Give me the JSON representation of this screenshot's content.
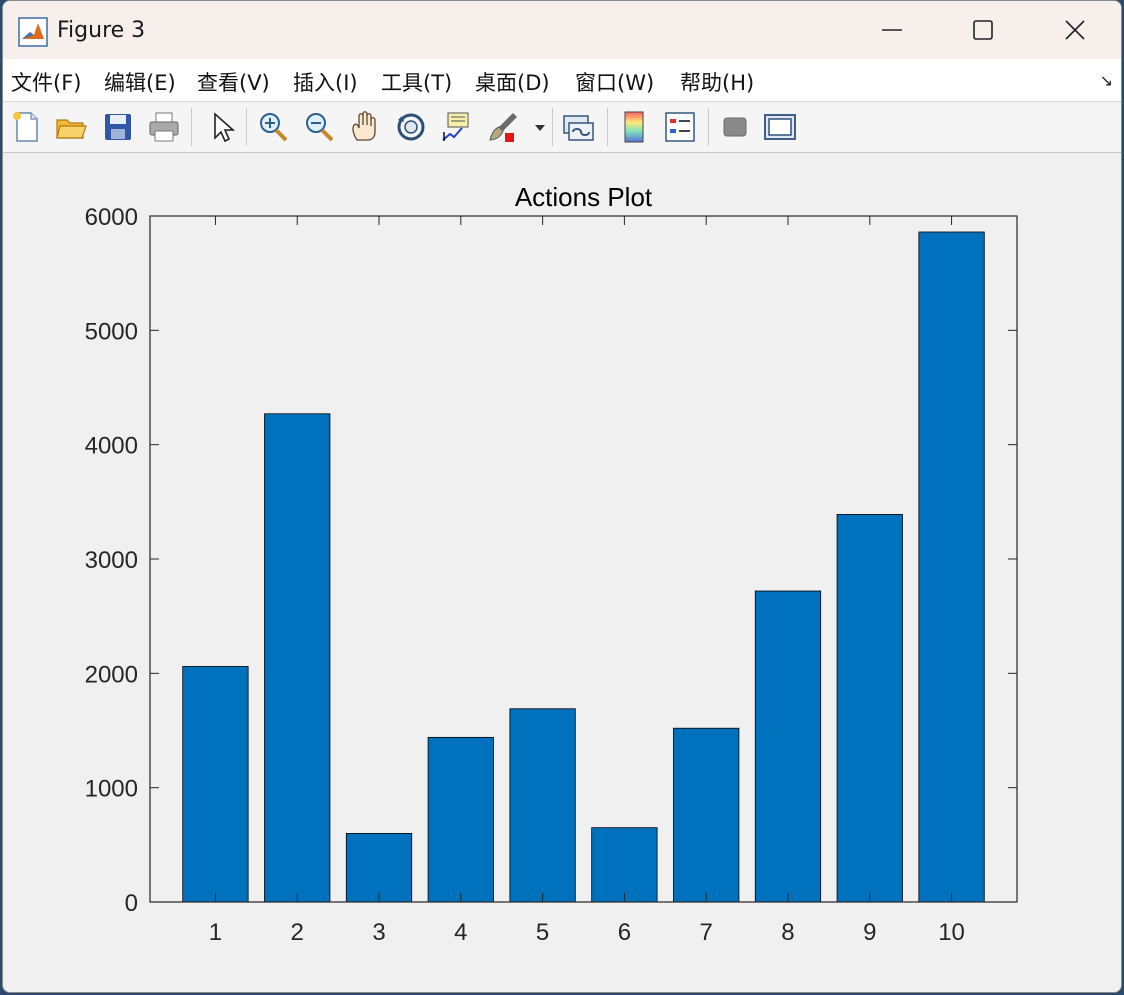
{
  "window": {
    "title": "Figure 3"
  },
  "menu": {
    "items": [
      "文件(F)",
      "编辑(E)",
      "查看(V)",
      "插入(I)",
      "工具(T)",
      "桌面(D)",
      "窗口(W)",
      "帮助(H)"
    ]
  },
  "toolbar": {
    "icons": [
      "new-figure-icon",
      "open-icon",
      "save-icon",
      "print-icon",
      "pointer-icon",
      "zoom-in-icon",
      "zoom-out-icon",
      "pan-hand-icon",
      "rotate-3d-icon",
      "data-cursor-icon",
      "brush-icon",
      "link-plot-icon",
      "colorbar-icon",
      "legend-icon",
      "hide-plot-tools-icon",
      "show-plot-tools-icon"
    ]
  },
  "chart_data": {
    "type": "bar",
    "title": "Actions Plot",
    "categories": [
      "1",
      "2",
      "3",
      "4",
      "5",
      "6",
      "7",
      "8",
      "9",
      "10"
    ],
    "values": [
      2060,
      4270,
      600,
      1440,
      1690,
      650,
      1520,
      2720,
      3390,
      5860
    ],
    "ylim": [
      0,
      6000
    ],
    "yticks": [
      0,
      1000,
      2000,
      3000,
      4000,
      5000,
      6000
    ],
    "xlabel": "",
    "ylabel": "",
    "bar_color": "#0072bd",
    "grid": false
  }
}
